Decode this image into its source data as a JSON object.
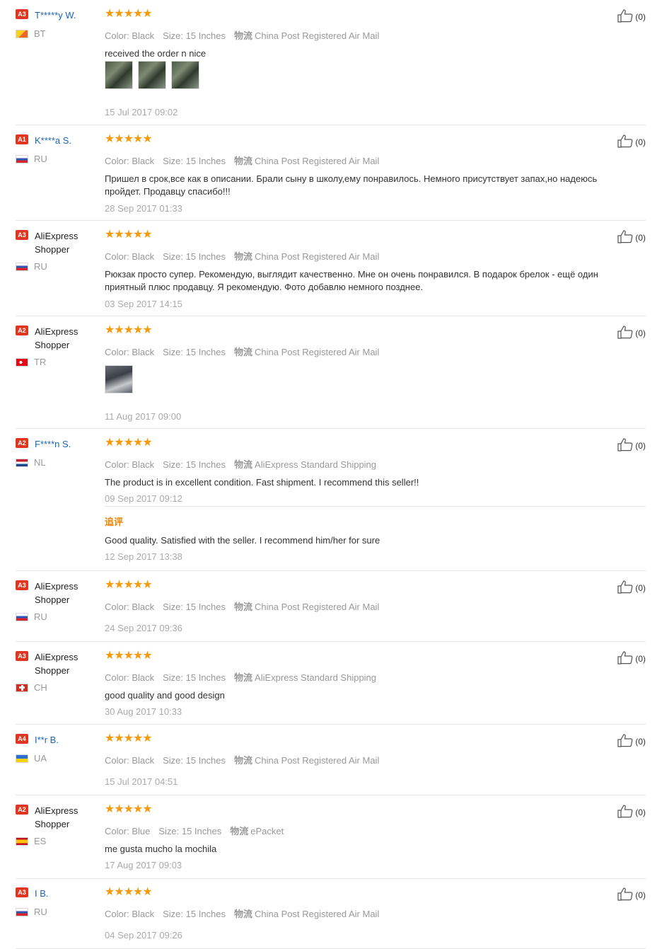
{
  "labels": {
    "color": "Color:",
    "size": "Size:",
    "shipping_icon": "物流",
    "followup_title": "追评"
  },
  "reviews": [
    {
      "level": "A3",
      "name": "T*****y W.",
      "masked": true,
      "country": "BT",
      "flag": "bt",
      "color": "Black",
      "size": "15 Inches",
      "shipping": "China Post Registered Air Mail",
      "text": "received the order n nice",
      "photos": 3,
      "date": "15 Jul 2017 09:02",
      "likes": "(0)"
    },
    {
      "level": "A1",
      "name": "K****a S.",
      "masked": true,
      "country": "RU",
      "flag": "ru",
      "color": "Black",
      "size": "15 Inches",
      "shipping": "China Post Registered Air Mail",
      "text": "Пришел в срок,все как в описании. Брали сыну в школу,ему понравилось. Немного присутствует запах,но надеюсь пройдет. Продавцу спасибо!!!",
      "photos": 0,
      "date": "28 Sep 2017 01:33",
      "likes": "(0)"
    },
    {
      "level": "A3",
      "name": "AliExpress Shopper",
      "masked": false,
      "country": "RU",
      "flag": "ru",
      "color": "Black",
      "size": "15 Inches",
      "shipping": "China Post Registered Air Mail",
      "text": "Рюкзак просто супер. Рекомендую, выглядит качественно. Мне он очень понравился. В подарок брелок - ещё один приятный плюс продавцу. Я рекомендую. Фото добавлю немного позднее.",
      "photos": 0,
      "date": "03 Sep 2017 14:15",
      "likes": "(0)"
    },
    {
      "level": "A2",
      "name": "AliExpress Shopper",
      "masked": false,
      "country": "TR",
      "flag": "tr",
      "color": "Black",
      "size": "15 Inches",
      "shipping": "China Post Registered Air Mail",
      "text": "",
      "photos": 1,
      "date": "11 Aug 2017 09:00",
      "likes": "(0)"
    },
    {
      "level": "A2",
      "name": "F****n S.",
      "masked": true,
      "country": "NL",
      "flag": "nl",
      "color": "Black",
      "size": "15 Inches",
      "shipping": "AliExpress Standard Shipping",
      "text": "The product is in excellent condition. Fast shipment. I recommend this seller!!",
      "photos": 0,
      "date": "09 Sep 2017 09:12",
      "likes": "(0)",
      "followup": {
        "text": "Good quality. Satisfied with the seller. I recommend him/her for sure",
        "date": "12 Sep 2017 13:38"
      }
    },
    {
      "level": "A3",
      "name": "AliExpress Shopper",
      "masked": false,
      "country": "RU",
      "flag": "ru",
      "color": "Black",
      "size": "15 Inches",
      "shipping": "China Post Registered Air Mail",
      "text": "",
      "photos": 0,
      "date": "24 Sep 2017 09:36",
      "likes": "(0)"
    },
    {
      "level": "A3",
      "name": "AliExpress Shopper",
      "masked": false,
      "country": "CH",
      "flag": "ch",
      "color": "Black",
      "size": "15 Inches",
      "shipping": "AliExpress Standard Shipping",
      "text": "good quality and good design",
      "photos": 0,
      "date": "30 Aug 2017 10:33",
      "likes": "(0)"
    },
    {
      "level": "A4",
      "name": "I**r B.",
      "masked": true,
      "country": "UA",
      "flag": "ua",
      "color": "Black",
      "size": "15 Inches",
      "shipping": "China Post Registered Air Mail",
      "text": "",
      "photos": 0,
      "date": "15 Jul 2017 04:51",
      "likes": "(0)"
    },
    {
      "level": "A2",
      "name": "AliExpress Shopper",
      "masked": false,
      "country": "ES",
      "flag": "es",
      "color": "Blue",
      "size": "15 Inches",
      "shipping": "ePacket",
      "text": "me gusta mucho la mochila",
      "photos": 0,
      "date": "17 Aug 2017 09:03",
      "likes": "(0)"
    },
    {
      "level": "A3",
      "name": "I B.",
      "masked": true,
      "country": "RU",
      "flag": "ru",
      "color": "Black",
      "size": "15 Inches",
      "shipping": "China Post Registered Air Mail",
      "text": "",
      "photos": 0,
      "date": "04 Sep 2017 09:26",
      "likes": "(0)"
    }
  ]
}
